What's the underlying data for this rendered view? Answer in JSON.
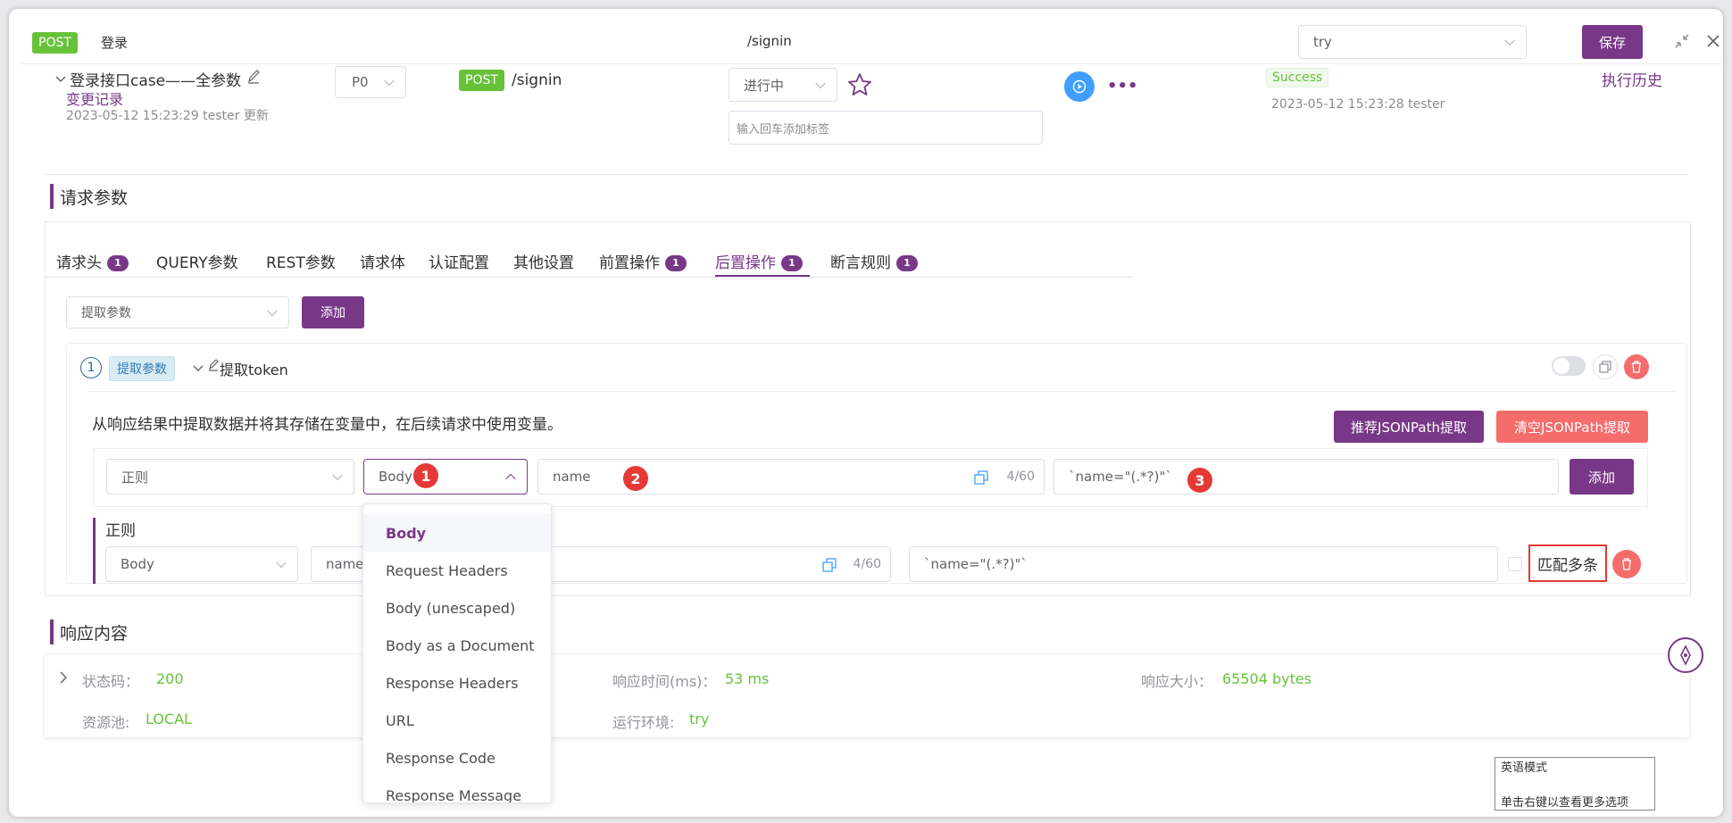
{
  "topbar": {
    "method": "POST",
    "name": "登录",
    "path": "/signin",
    "env_select": "try",
    "save_label": "保存"
  },
  "case": {
    "title": "登录接口case——全参数",
    "change_log": "变更记录",
    "updated": "2023-05-12 15:23:29 tester 更新",
    "priority": "P0",
    "method": "POST",
    "path": "/signin",
    "status": "进行中",
    "tag_placeholder": "输入回车添加标签",
    "result": "Success",
    "result_time": "2023-05-12 15:23:28 tester",
    "history": "执行历史"
  },
  "request": {
    "section_title": "请求参数",
    "tabs": [
      {
        "label": "请求头",
        "count": "1"
      },
      {
        "label": "QUERY参数",
        "count": ""
      },
      {
        "label": "REST参数",
        "count": ""
      },
      {
        "label": "请求体",
        "count": ""
      },
      {
        "label": "认证配置",
        "count": ""
      },
      {
        "label": "其他设置",
        "count": ""
      },
      {
        "label": "前置操作",
        "count": "1"
      },
      {
        "label": "后置操作",
        "count": "1"
      },
      {
        "label": "断言规则",
        "count": "1"
      }
    ],
    "active_tab": "后置操作",
    "op_select": "提取参数",
    "add_label": "添加"
  },
  "extract": {
    "index": "1",
    "type_tag": "提取参数",
    "name": "提取token",
    "description": "从响应结果中提取数据并将其存储在变量中，在后续请求中使用变量。",
    "recommend_btn": "推荐JSONPath提取",
    "clear_btn": "清空JSONPath提取",
    "row1": {
      "method": "正则",
      "source": "Body",
      "var_name": "name",
      "counter": "4/60",
      "expression": "`name=\"(.*?)\"`",
      "add_label": "添加"
    },
    "group_title": "正则",
    "row2": {
      "source": "Body",
      "var_name": "name",
      "counter": "4/60",
      "expression": "`name=\"(.*?)\"`",
      "match_multi": "匹配多条"
    },
    "markers": [
      "1",
      "2",
      "3"
    ]
  },
  "dropdown": {
    "options": [
      "Body",
      "Request Headers",
      "Body (unescaped)",
      "Body as a Document",
      "Response Headers",
      "URL",
      "Response Code",
      "Response Message"
    ],
    "selected": "Body"
  },
  "response": {
    "section_title": "响应内容",
    "status_label": "状态码：",
    "status_value": "200",
    "time_label": "响应时间(ms)：",
    "time_value": "53 ms",
    "size_label": "响应大小：",
    "size_value": "65504 bytes",
    "pool_label": "资源池:",
    "pool_value": "LOCAL",
    "env_label": "运行环境:",
    "env_value": "try"
  },
  "ime_tooltip": {
    "line1": "英语模式",
    "line2": "单击右键以查看更多选项"
  },
  "colors": {
    "brand": "#783887",
    "success": "#67c23a",
    "danger": "#f56c6c",
    "marker": "#e53935"
  }
}
